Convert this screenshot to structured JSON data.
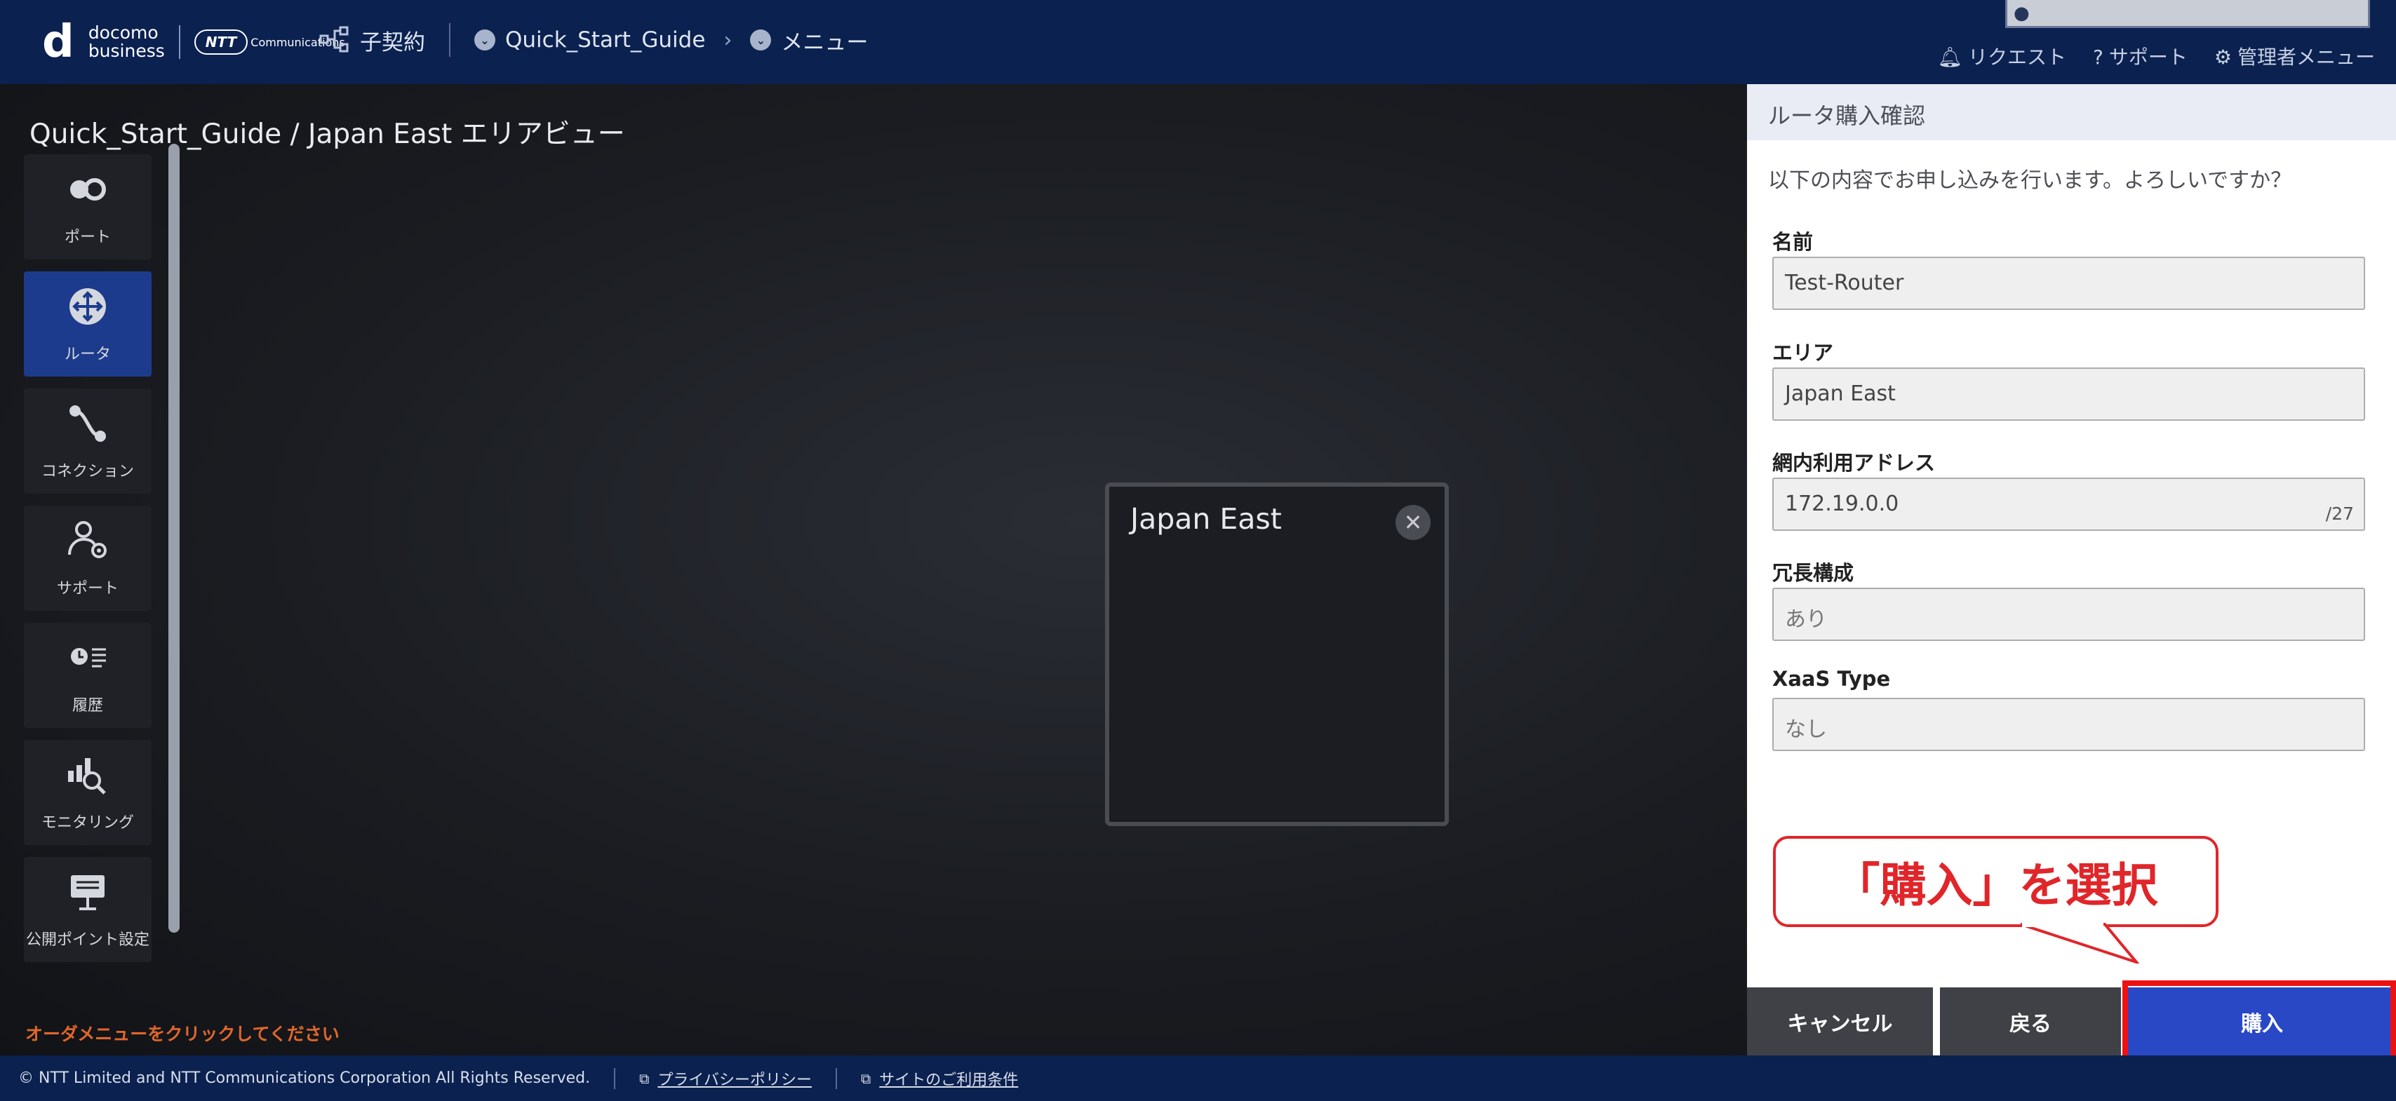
{
  "header": {
    "logo_mark": "d",
    "logo_line1": "docomo",
    "logo_line2": "business",
    "ntt_badge": "NTT",
    "ntt_sub": "Communications",
    "nav_contract": "子契約",
    "nav_project": "Quick_Start_Guide",
    "nav_menu": "メニュー",
    "links": {
      "request": "リクエスト",
      "support": "サポート",
      "admin": "管理者メニュー"
    }
  },
  "main": {
    "page_title": "Quick_Start_Guide / Japan East エリアビュー",
    "order_message": "オーダメニューをクリックしてください",
    "area_card_title": "Japan East"
  },
  "sidebar": {
    "items": [
      {
        "label": "ポート",
        "icon": "port-icon"
      },
      {
        "label": "ルータ",
        "icon": "router-icon"
      },
      {
        "label": "コネクション",
        "icon": "connection-icon"
      },
      {
        "label": "サポート",
        "icon": "support-icon"
      },
      {
        "label": "履歴",
        "icon": "history-icon"
      },
      {
        "label": "モニタリング",
        "icon": "monitoring-icon"
      },
      {
        "label": "公開ポイント設定",
        "icon": "public-point-icon"
      }
    ]
  },
  "panel": {
    "title": "ルータ購入確認",
    "description": "以下の内容でお申し込みを行います。よろしいですか？",
    "fields": {
      "name_label": "名前",
      "name_value": "Test-Router",
      "area_label": "エリア",
      "area_value": "Japan East",
      "address_label": "網内利用アドレス",
      "address_value": "172.19.0.0",
      "address_suffix": "/27",
      "redundancy_label": "冗長構成",
      "redundancy_value": "あり",
      "xaas_label": "XaaS Type",
      "xaas_value": "なし"
    },
    "buttons": {
      "cancel": "キャンセル",
      "back": "戻る",
      "buy": "購入"
    },
    "callout": "「購入」を選択"
  },
  "footer": {
    "copyright": "© NTT Limited and NTT Communications Corporation All Rights Reserved.",
    "privacy": "プライバシーポリシー",
    "terms": "サイトのご利用条件"
  },
  "colors": {
    "header_bg": "#0b2150",
    "active_sidebar": "#1c3b8c",
    "buy_button": "#2948c6",
    "highlight_red": "#ee1111",
    "order_message": "#e0672a"
  }
}
